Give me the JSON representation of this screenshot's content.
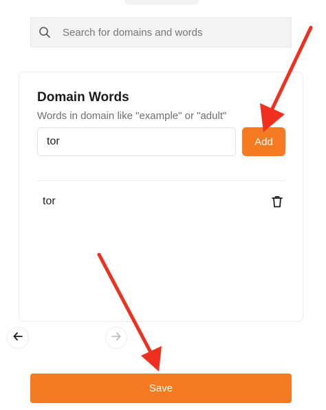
{
  "search": {
    "placeholder": "Search for domains and words",
    "icon": "search-icon"
  },
  "domain_words": {
    "title": "Domain Words",
    "subtitle": "Words in domain like \"example\" or \"adult\"",
    "input_value": "tor",
    "add_label": "Add",
    "items": [
      {
        "word": "tor",
        "delete_icon": "trash-icon"
      }
    ]
  },
  "navigation": {
    "prev_icon": "arrow-left-icon",
    "next_icon": "arrow-right-icon"
  },
  "footer": {
    "save_label": "Save"
  },
  "colors": {
    "accent": "#f57a21",
    "annotation_arrow": "#f0301e"
  }
}
